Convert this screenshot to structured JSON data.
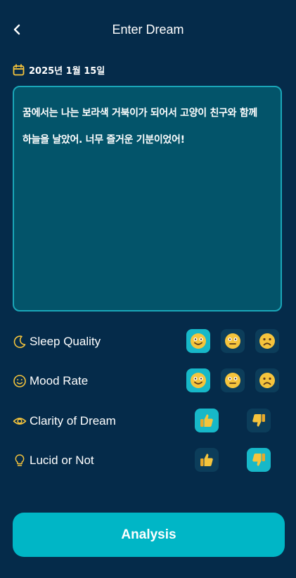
{
  "header": {
    "title": "Enter Dream"
  },
  "date": {
    "text": "2025년 1월 15일"
  },
  "dream": {
    "text": "꿈에서는 나는 보라색 거북이가 되어서 고양이 친구와 함께\n하늘을 날았어. 너무 즐거운 기분이었어!"
  },
  "ratings": {
    "sleep_quality": {
      "label": "Sleep Quality",
      "options": [
        "happy",
        "neutral",
        "sad"
      ],
      "selected": "happy"
    },
    "mood_rate": {
      "label": "Mood Rate",
      "options": [
        "happy",
        "neutral",
        "sad"
      ],
      "selected": "happy"
    },
    "clarity": {
      "label": "Clarity of Dream",
      "options": [
        "thumbs-up",
        "thumbs-down"
      ],
      "selected": "thumbs-up"
    },
    "lucid": {
      "label": "Lucid or Not",
      "options": [
        "thumbs-up",
        "thumbs-down"
      ],
      "selected": "thumbs-down"
    }
  },
  "button": {
    "label": "Analysis"
  },
  "colors": {
    "background": "#052b4a",
    "accent": "#00b6c6",
    "icon_yellow": "#f5c43c",
    "text_box": "#03546a"
  }
}
